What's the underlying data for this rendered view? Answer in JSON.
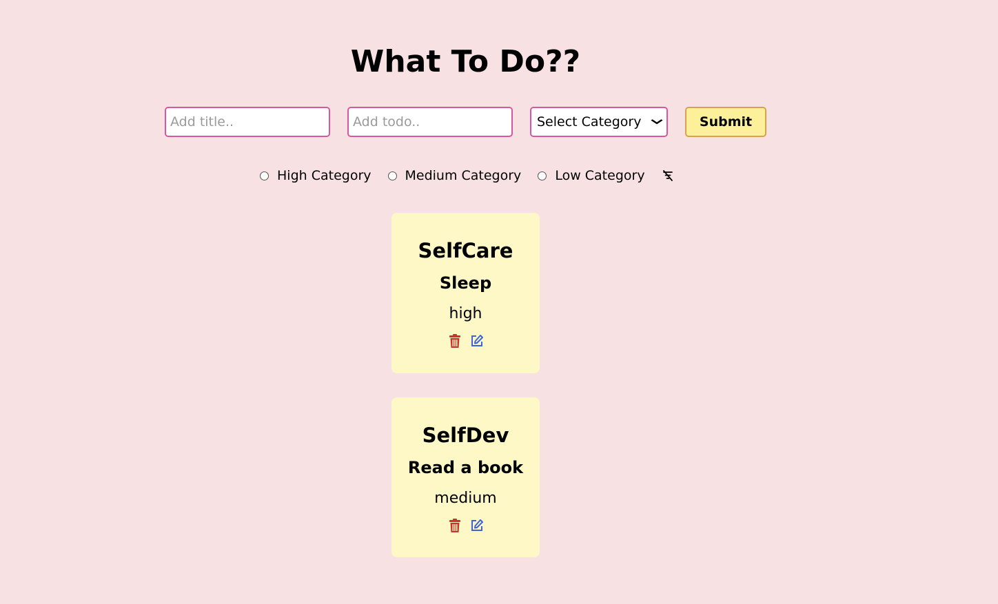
{
  "header": {
    "title": "What To Do??"
  },
  "form": {
    "title_placeholder": "Add title..",
    "todo_placeholder": "Add todo..",
    "category_selected": "Select Category",
    "submit_label": "Submit"
  },
  "filters": {
    "options": [
      {
        "label": "High Category",
        "checked": false
      },
      {
        "label": "Medium Category",
        "checked": false
      },
      {
        "label": "Low Category",
        "checked": false
      }
    ],
    "clear_icon": "filter-off-icon"
  },
  "todos": [
    {
      "title": "SelfCare",
      "todo": "Sleep",
      "priority": "high"
    },
    {
      "title": "SelfDev",
      "todo": "Read a book",
      "priority": "medium"
    }
  ],
  "colors": {
    "background": "#f8e1e2",
    "input_border": "#d6579f",
    "submit_bg": "#fdf09a",
    "submit_border": "#d7a24a",
    "card_bg": "#fdf8c6",
    "delete_icon": "#c8342b",
    "edit_icon": "#3d63d6"
  }
}
